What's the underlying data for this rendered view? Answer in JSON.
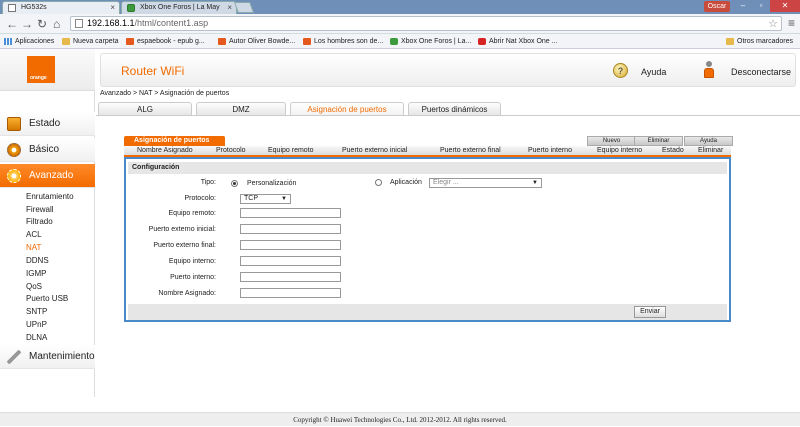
{
  "browser": {
    "tabs": [
      {
        "label": "HG532s",
        "active": true
      },
      {
        "label": "Xbox One Foros | La May",
        "active": false
      }
    ],
    "user_badge": "Oscar",
    "address": {
      "host": "192.168.1.1",
      "path": "/html/content1.asp"
    },
    "bookmarks": [
      {
        "label": "Aplicaciones",
        "icon": "apps-icon"
      },
      {
        "label": "Nueva carpeta",
        "icon": "folder-icon"
      },
      {
        "label": "espaebook - epub g...",
        "icon": "bookmark-icon"
      },
      {
        "label": "Autor Oliver Bowde...",
        "icon": "bookmark-icon"
      },
      {
        "label": "Los hombres son de...",
        "icon": "bookmark-icon"
      },
      {
        "label": "Xbox One Foros | La...",
        "icon": "xbox-icon"
      },
      {
        "label": "Abrir Nat Xbox One ...",
        "icon": "youtube-icon"
      }
    ],
    "other_bookmarks": "Otros marcadores"
  },
  "header": {
    "logo_text": "orange",
    "title": "Router WiFi",
    "help": "Ayuda",
    "help_glyph": "?",
    "logout": "Desconectarse"
  },
  "sidebar": {
    "items": [
      {
        "label": "Estado"
      },
      {
        "label": "Básico"
      },
      {
        "label": "Avanzado",
        "active": true
      }
    ],
    "sub_items": [
      "Enrutamiento",
      "Firewall",
      "Filtrado",
      "ACL",
      "NAT",
      "DDNS",
      "IGMP",
      "QoS",
      "Puerto USB",
      "SNTP",
      "UPnP",
      "DLNA"
    ],
    "active_sub": "NAT",
    "maintenance": "Mantenimiento"
  },
  "breadcrumb": "Avanzado > NAT > Asignación de puertos",
  "page_tabs": [
    "ALG",
    "DMZ",
    "Asignación de puertos",
    "Puertos dinámicos"
  ],
  "active_tab": "Asignación de puertos",
  "section": {
    "title": "Asignación de puertos",
    "buttons": {
      "new": "Nuevo",
      "delete": "Eliminar",
      "help": "Ayuda"
    },
    "columns": [
      "Nombre Asignado",
      "Protocolo",
      "Equipo remoto",
      "Puerto externo inicial",
      "Puerto externo final",
      "Puerto interno",
      "Equipo interno",
      "Estado",
      "Eliminar"
    ]
  },
  "config": {
    "title": "Configuración",
    "tipo_label": "Tipo:",
    "tipo_custom": "Personalización",
    "tipo_app": "Aplicación",
    "app_placeholder": "Elegir ...",
    "protocol_label": "Protocolo:",
    "protocol_value": "TCP",
    "fields": [
      {
        "label": "Equipo remoto:",
        "value": ""
      },
      {
        "label": "Puerto externo inicial:",
        "value": ""
      },
      {
        "label": "Puerto externo final:",
        "value": ""
      },
      {
        "label": "Equipo interno:",
        "value": ""
      },
      {
        "label": "Puerto interno:",
        "value": ""
      },
      {
        "label": "Nombre Asignado:",
        "value": ""
      }
    ],
    "submit": "Enviar"
  },
  "footer": "Copyright © Huawei Technologies Co., Ltd. 2012-2012. All rights reserved.",
  "colors": {
    "accent": "#f26b00",
    "panel_border": "#4a8ac8"
  }
}
